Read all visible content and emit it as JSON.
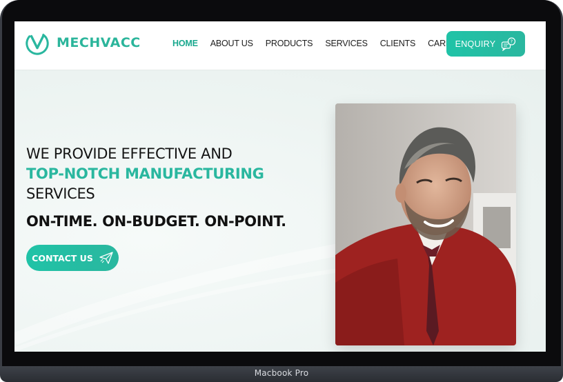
{
  "device": {
    "label": "Macbook Pro"
  },
  "brand": {
    "name": "MECHVACC",
    "accent": "#2ab79f"
  },
  "nav": {
    "items": [
      {
        "label": "HOME",
        "active": true
      },
      {
        "label": "ABOUT US"
      },
      {
        "label": "PRODUCTS"
      },
      {
        "label": "SERVICES"
      },
      {
        "label": "CLIENTS"
      },
      {
        "label": "CARRERS"
      }
    ],
    "cta_label": "ENQUIRY",
    "cta_icon": "chat-question-icon"
  },
  "hero": {
    "line1": "WE PROVIDE EFFECTIVE AND",
    "line2": "TOP-NOTCH MANUFACTURING",
    "line3": "SERVICES",
    "tagline": "ON-TIME. ON-BUDGET. ON-POINT.",
    "button_label": "CONTACT US",
    "button_icon": "paper-plane-icon",
    "image_subject": "smiling man in red jacket"
  }
}
